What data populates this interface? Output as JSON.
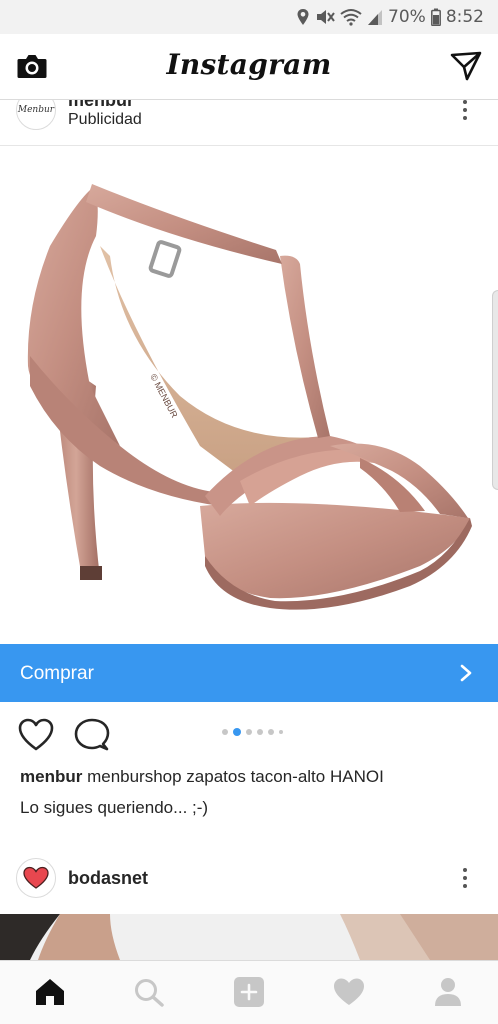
{
  "status_bar": {
    "battery_percent": "70%",
    "time": "8:52",
    "icons": [
      "location-icon",
      "mute-icon",
      "wifi-icon",
      "signal-icon",
      "battery-icon"
    ]
  },
  "header": {
    "title": "Instagram",
    "left_icon": "camera-icon",
    "right_icon": "direct-message-icon"
  },
  "post": {
    "username": "menbur",
    "sponsored_label": "Publicidad",
    "avatar_text": "Menbur",
    "cta_label": "Comprar",
    "carousel_pages": 6,
    "carousel_active": 1,
    "caption_user": "menbur",
    "caption_text": "menburshop zapatos tacon-alto  HANOI",
    "caption_line2": "Lo sigues queriendo... ;-)",
    "image_subject": "high-heel-sandal"
  },
  "next_post": {
    "username": "bodasnet",
    "avatar_icon": "heart-logo-icon"
  },
  "tabbar": {
    "items": [
      "home-icon",
      "search-icon",
      "add-icon",
      "activity-icon",
      "profile-icon"
    ],
    "active": "home-icon"
  },
  "colors": {
    "cta_background": "#3897f0",
    "carousel_active_dot": "#3897f0",
    "status_bar": "#f2f2f2",
    "shoe": "#c9978a"
  }
}
